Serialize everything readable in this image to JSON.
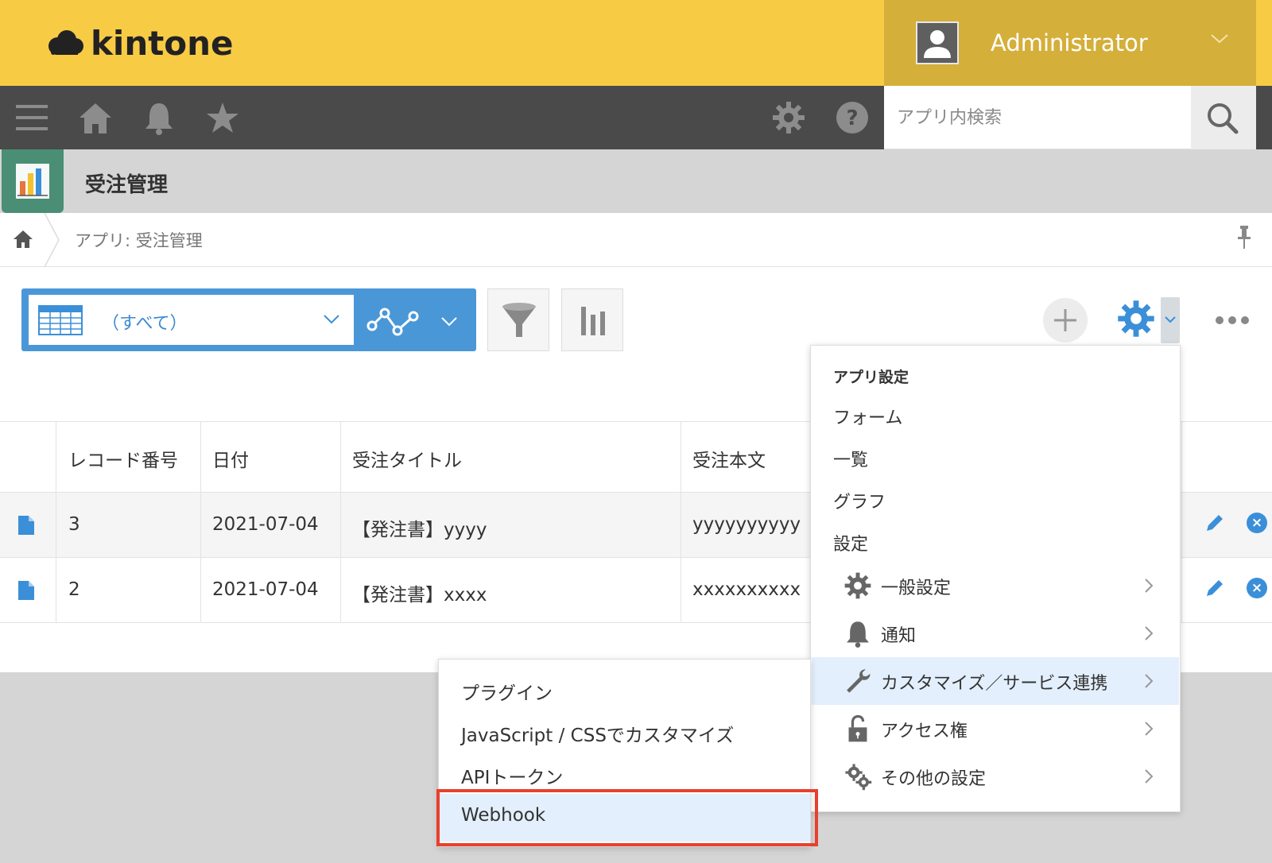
{
  "header": {
    "logo_text": "kintone",
    "user_name": "Administrator"
  },
  "search": {
    "placeholder": "アプリ内検索"
  },
  "app": {
    "title": "受注管理"
  },
  "breadcrumb": {
    "text": "アプリ: 受注管理"
  },
  "view": {
    "selected": "（すべて）"
  },
  "table": {
    "columns": [
      "レコード番号",
      "日付",
      "受注タイトル",
      "受注本文"
    ],
    "rows": [
      {
        "record_no": "3",
        "date": "2021-07-04",
        "title": "【発注書】yyyy",
        "body": "yyyyyyyyyy"
      },
      {
        "record_no": "2",
        "date": "2021-07-04",
        "title": "【発注書】xxxx",
        "body": "xxxxxxxxxx"
      }
    ]
  },
  "settings_menu": {
    "heading": "アプリ設定",
    "items": [
      "フォーム",
      "一覧",
      "グラフ",
      "設定"
    ],
    "sub_items": [
      {
        "label": "一般設定",
        "icon": "gear-icon"
      },
      {
        "label": "通知",
        "icon": "bell-icon"
      },
      {
        "label": "カスタマイズ／サービス連携",
        "icon": "wrench-icon",
        "active": true
      },
      {
        "label": "アクセス権",
        "icon": "lock-icon"
      },
      {
        "label": "その他の設定",
        "icon": "gears-icon"
      }
    ]
  },
  "customize_submenu": {
    "items": [
      "プラグイン",
      "JavaScript / CSSでカスタマイズ",
      "APIトークン",
      "Webhook"
    ],
    "highlighted": "Webhook"
  },
  "colors": {
    "header_yellow": "#f8cb45",
    "user_panel": "#d4af3a",
    "nav_dark": "#4a4a4a",
    "accent_blue": "#4a97d8",
    "highlight_red": "#e8402d",
    "app_icon_green": "#4a8f75"
  }
}
